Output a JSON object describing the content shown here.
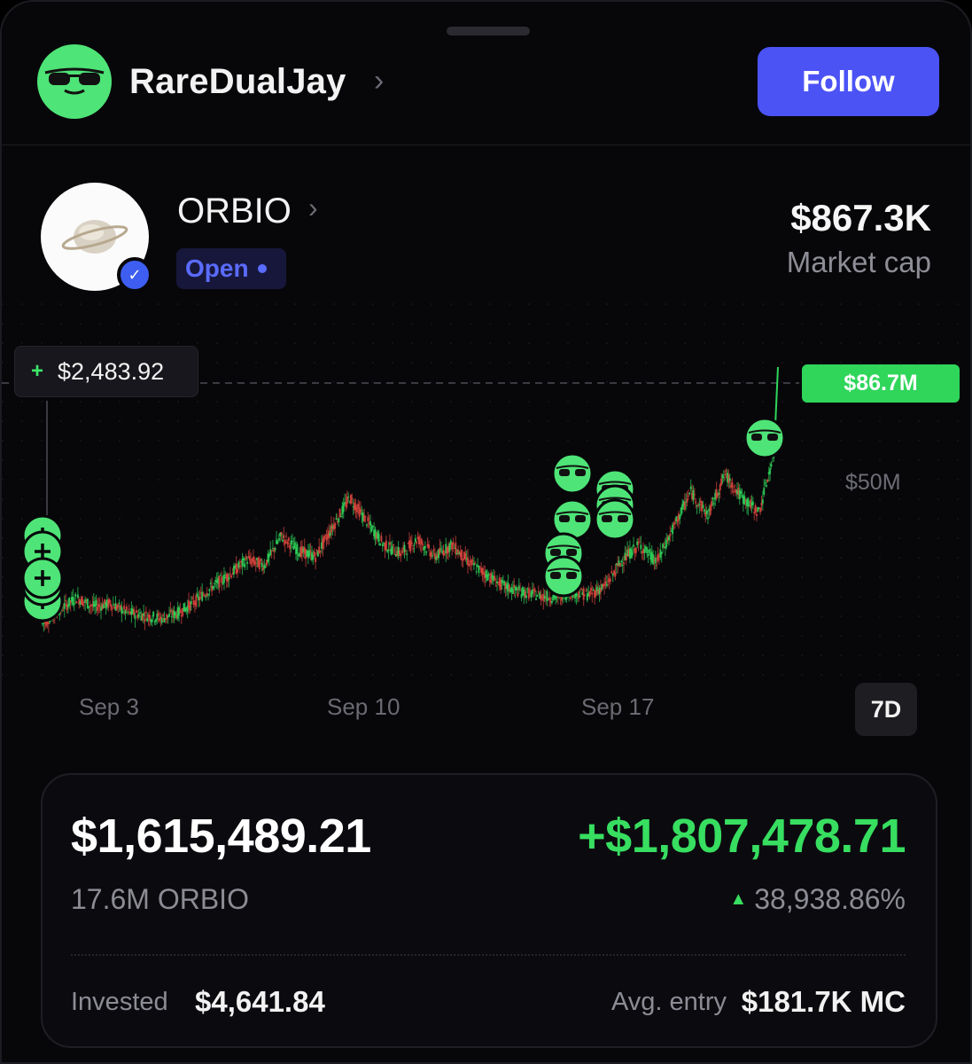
{
  "user": {
    "name": "RareDualJay",
    "avatar_icon": "sunglasses-icon",
    "follow_label": "Follow"
  },
  "token": {
    "name": "ORBIO",
    "status": "Open",
    "market_cap": "$867.3K",
    "market_cap_label": "Market cap",
    "avatar_icon": "planet-icon"
  },
  "chart": {
    "tooltip_value": "$2,483.92",
    "current_label": "$86.7M",
    "y_label": "$50M",
    "x_labels": [
      "Sep 3",
      "Sep 10",
      "Sep 17"
    ],
    "range": "7D"
  },
  "position": {
    "value": "$1,615,489.21",
    "pnl": "+$1,807,478.71",
    "holdings": "17.6M ORBIO",
    "pnl_pct": "38,938.86%",
    "invested_label": "Invested",
    "invested_value": "$4,641.84",
    "avg_entry_label": "Avg. entry",
    "avg_entry_value": "$181.7K MC"
  },
  "colors": {
    "accent": "#4b53f5",
    "positive": "#37de60",
    "up_candle": "#2fd65a",
    "down_candle": "#e0463e",
    "background": "#07070a"
  },
  "chart_data": {
    "type": "line",
    "x_labels": [
      "Sep 3",
      "Sep 10",
      "Sep 17"
    ],
    "y_label": "$50M",
    "current": "$86.7M",
    "x": [
      0,
      0.5,
      1,
      1.5,
      2,
      2.5,
      3,
      3.5,
      4,
      4.5,
      5,
      5.5,
      6,
      6.5,
      7,
      7.5,
      8,
      8.5,
      9,
      9.5,
      10,
      10.5,
      11,
      11.5,
      12,
      12.5,
      13,
      13.5,
      14,
      14.5,
      15,
      15.5,
      16,
      16.5,
      17,
      17.5,
      18,
      18.5,
      19,
      19.5,
      20,
      20.5,
      21,
      21.5
    ],
    "values": [
      3,
      8,
      12,
      9,
      10,
      7,
      6,
      5,
      7,
      11,
      16,
      20,
      25,
      23,
      33,
      28,
      26,
      36,
      46,
      38,
      30,
      27,
      32,
      26,
      30,
      24,
      20,
      16,
      14,
      13,
      12,
      14,
      13,
      16,
      25,
      30,
      24,
      36,
      48,
      40,
      54,
      46,
      41,
      64
    ],
    "ylim": [
      0,
      100
    ]
  }
}
